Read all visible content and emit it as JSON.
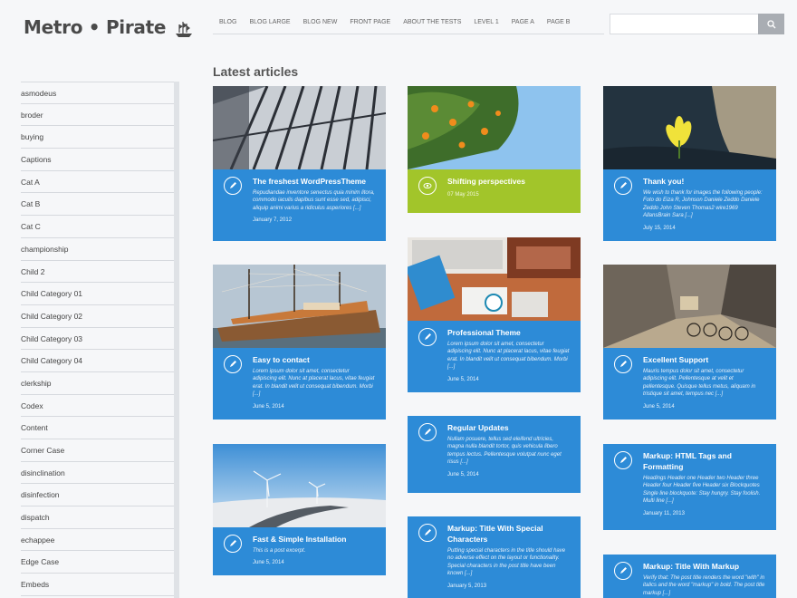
{
  "site": {
    "name_left": "Metro",
    "name_right": "Pirate"
  },
  "nav": [
    "BLOG",
    "BLOG LARGE",
    "BLOG NEW",
    "FRONT PAGE",
    "ABOUT THE TESTS",
    "LEVEL 1",
    "PAGE A",
    "PAGE B"
  ],
  "search": {
    "placeholder": ""
  },
  "section_title": "Latest articles",
  "sidebar": [
    "asmodeus",
    "broder",
    "buying",
    "Captions",
    "Cat A",
    "Cat B",
    "Cat C",
    "championship",
    "Child 2",
    "Child Category 01",
    "Child Category 02",
    "Child Category 03",
    "Child Category 04",
    "clerkship",
    "Codex",
    "Content",
    "Corner Case",
    "disinclination",
    "disinfection",
    "dispatch",
    "echappee",
    "Edge Case",
    "Embeds"
  ],
  "cards": [
    {
      "title": "The freshest WordPressTheme",
      "excerpt": "Repudiandae inventore senectus quia minim litora, commodo iaculis dapibus sunt esse sed, adipisci, aliquip animi varius a ridiculus asperiores [...]",
      "date": "January 7, 2012",
      "icon": "pencil-icon",
      "image": "building-glass",
      "color": "#2d8bd7"
    },
    {
      "title": "Easy to contact",
      "excerpt": "Lorem ipsum dolor sit amet, consectetur adipiscing elit. Nunc at placerat lacus, vitae feugiat erat. In blandit velit ut consequat bibendum. Morbi [...]",
      "date": "June 5, 2014",
      "icon": "pencil-icon",
      "image": "ship-harbor",
      "color": "#2d8bd7"
    },
    {
      "title": "Fast & Simple Installation",
      "excerpt": "This is a post excerpt.",
      "date": "June 5, 2014",
      "icon": "pencil-icon",
      "image": "wind-turbines",
      "color": "#2d8bd7"
    },
    {
      "title": "Shifting perspectives",
      "excerpt": "",
      "date": "07 May 2015",
      "icon": "eye-icon",
      "image": "orange-tree",
      "color": "#a2c52a"
    },
    {
      "title": "Professional Theme",
      "excerpt": "Lorem ipsum dolor sit amet, consectetur adipiscing elit. Nunc at placerat lacus, vitae feugiat erat. In blandit velit ut consequat bibendum. Morbi [...]",
      "date": "June 5, 2014",
      "icon": "pencil-icon",
      "image": "desk-workspace",
      "color": "#2d8bd7"
    },
    {
      "title": "Regular Updates",
      "excerpt": "Nullam posuere, tellus sed eleifend ultricies, magna nulla blandit tortor, quis vehicula libero tempus lectus. Pellentesque volutpat nunc eget risus [...]",
      "date": "June 5, 2014",
      "icon": "pencil-icon",
      "image": "",
      "color": "#2d8bd7"
    },
    {
      "title": "Markup: Title With Special Characters",
      "excerpt": "Putting special characters in the title should have no adverse effect on the layout or functionality. Special characters in the post title have been known [...]",
      "date": "January 5, 2013",
      "icon": "pencil-icon",
      "image": "",
      "color": "#2d8bd7"
    },
    {
      "title": "Thank you!",
      "excerpt": "We wish to thank for images the following people: Foto do Eiza R, Johnson Daniele Zeddo Daniele Zeddo John Steven Thomas2 wire1969 AllansBrain Sara [...]",
      "date": "July 15, 2014",
      "icon": "pencil-icon",
      "image": "yellow-flower",
      "color": "#2d8bd7"
    },
    {
      "title": "Excellent Support",
      "excerpt": "Mauris tempus dolor sit amet, consectetur adipiscing elit. Pellentesque at velit et pellentesque. Quisque tellus metus, aliquam in tristique sit amet, tempus nec [...]",
      "date": "June 5, 2014",
      "icon": "pencil-icon",
      "image": "bicycles-street",
      "color": "#2d8bd7"
    },
    {
      "title": "Markup: HTML Tags and Formatting",
      "excerpt": "Headings Header one Header two Header three Header four Header five Header six Blockquotes Single line blockquote: Stay hungry. Stay foolish. Multi line [...]",
      "date": "January 11, 2013",
      "icon": "pencil-icon",
      "image": "",
      "color": "#2d8bd7"
    },
    {
      "title": "Markup: Title With Markup",
      "excerpt": "Verify that: The post title renders the word \"with\" in italics and the word \"markup\" in bold. The post title markup [...]",
      "date": "",
      "icon": "pencil-icon",
      "image": "",
      "color": "#2d8bd7"
    }
  ]
}
